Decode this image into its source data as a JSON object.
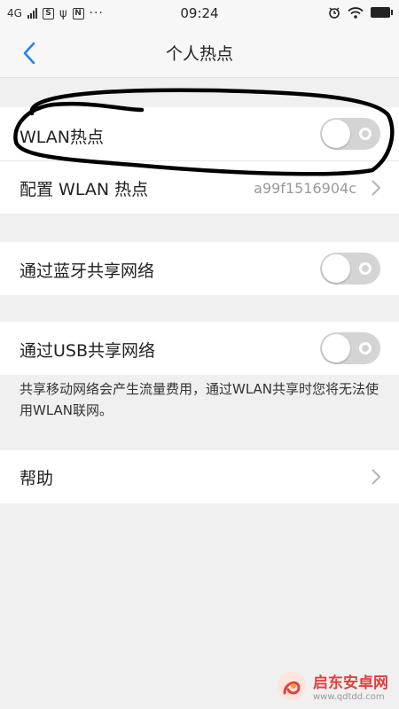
{
  "status_bar": {
    "network": "4G",
    "time": "09:24",
    "left_icon_labels": [
      "S",
      "N"
    ],
    "battery_color": "#222222"
  },
  "header": {
    "title": "个人热点",
    "back_icon": "chevron-left-icon",
    "accent": "#2a82e4"
  },
  "settings": {
    "wlan_hotspot": {
      "label": "WLAN热点",
      "enabled": false
    },
    "configure_wlan": {
      "label": "配置 WLAN 热点",
      "value": "a99f1516904c"
    },
    "bluetooth_tether": {
      "label": "通过蓝牙共享网络",
      "enabled": false
    },
    "usb_tether": {
      "label": "通过USB共享网络",
      "enabled": false
    },
    "note": "共享移动网络会产生流量费用，通过WLAN共享时您将无法使用WLAN联网。",
    "help": {
      "label": "帮助"
    }
  },
  "watermark": {
    "name": "启东安卓网",
    "url": "www.qdtdd.com",
    "color": "#e04040"
  }
}
